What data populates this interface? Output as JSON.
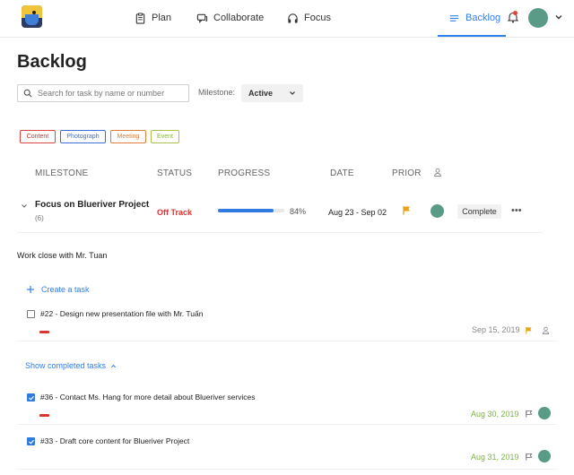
{
  "nav": {
    "plan": "Plan",
    "collaborate": "Collaborate",
    "focus": "Focus",
    "backlog": "Backlog",
    "accent": "#2f80ed"
  },
  "page": {
    "title": "Backlog"
  },
  "search": {
    "placeholder": "Search for task by name or number"
  },
  "milestone_filter": {
    "label": "Milestone:",
    "value": "Active"
  },
  "tags": [
    "Content",
    "Photograph",
    "Meeting",
    "Event"
  ],
  "table": {
    "headers": {
      "milestone": "MILESTONE",
      "status": "STATUS",
      "progress": "PROGRESS",
      "date": "DATE",
      "priority": "PRIOR"
    }
  },
  "milestone": {
    "name": "Focus on Blueriver Project",
    "count": "(6)",
    "status": "Off Track",
    "progress_label": "84%",
    "progress_value": 0.84,
    "date": "Aug 23 - Sep 02",
    "complete_label": "Complete",
    "more_label": "•••",
    "description": "Work close with Mr. Tuan"
  },
  "create_task": "Create a task",
  "tasks_open": [
    {
      "title": "#22 - Design new presentation file with Mr. Tuấn",
      "date": "Sep 15, 2019"
    }
  ],
  "show_completed": "Show completed tasks",
  "tasks_done": [
    {
      "title": "#36 - Contact Ms. Hang for more detail about Blueriver services",
      "date": "Aug 30, 2019"
    },
    {
      "title": "#33 - Draft core content for Blueriver Project",
      "date": "Aug 31, 2019"
    }
  ]
}
